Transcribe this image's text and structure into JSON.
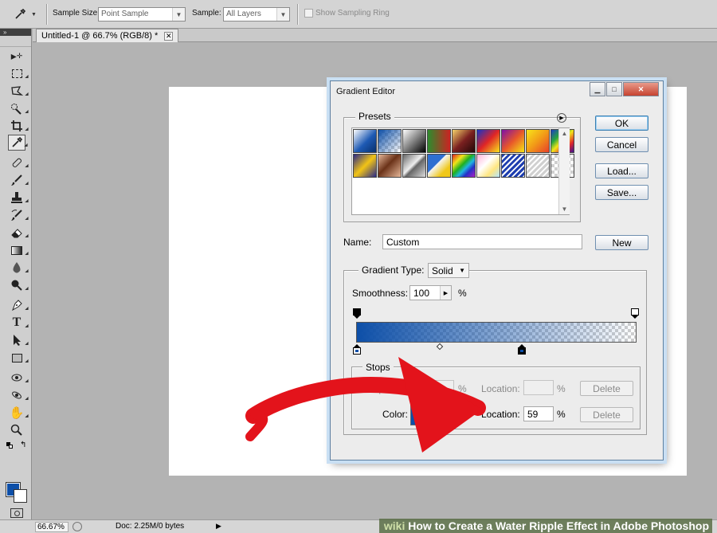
{
  "options_bar": {
    "sample_size_label": "Sample Size:",
    "sample_size_value": "Point Sample",
    "sample_label": "Sample:",
    "sample_value": "All Layers",
    "show_ring_label": "Show Sampling Ring"
  },
  "document": {
    "tab_title": "Untitled-1 @ 66.7% (RGB/8) *",
    "close_glyph": "✕"
  },
  "status_bar": {
    "zoom": "66.67%",
    "doc_info": "Doc: 2.25M/0 bytes",
    "play_glyph": "▶"
  },
  "watermark": {
    "brand": "wiki",
    "text": "How to Create a Water Ripple Effect in Adobe Photoshop"
  },
  "colors": {
    "foreground": "#0d4fa8",
    "background": "#ffffff",
    "arrow_red": "#e3131b"
  },
  "gradient_editor": {
    "title": "Gradient Editor",
    "presets_label": "Presets",
    "buttons": {
      "ok": "OK",
      "cancel": "Cancel",
      "load": "Load...",
      "save": "Save...",
      "new": "New"
    },
    "name_label": "Name:",
    "name_value": "Custom",
    "gradient_type_label": "Gradient Type:",
    "gradient_type_value": "Solid",
    "smoothness_label": "Smoothness:",
    "smoothness_value": "100",
    "percent": "%",
    "stops": {
      "legend": "Stops",
      "opacity_label": "Opacity:",
      "opacity_value": "",
      "location_label": "Location:",
      "color_label": "Color:",
      "color_location_value": "59",
      "delete_label": "Delete"
    }
  },
  "presets": [
    "linear-gradient(135deg,#ffffff,#1e5ab4 55%,#08306c)",
    "checker-blue",
    "linear-gradient(135deg,#ffffff,#000000)",
    "linear-gradient(to right,#2d8c2d,#cc2222)",
    "linear-gradient(135deg,#f5d36a,#7a2020 50%,#200808)",
    "linear-gradient(135deg,#1633c8,#e02525 50%,#f7e41e)",
    "linear-gradient(135deg,#7d10a8,#e8562a 50%,#f5e616)",
    "linear-gradient(135deg,#f8e51a,#f29b17 50%,#e8402a)",
    "linear-gradient(135deg,#1d3ec2,#27a53e 30%,#f1e51a 50%,#e12a2a 75%,#3b1094)",
    "linear-gradient(135deg,#2a2a8a,#f2c415 50%,#2a2a8a)",
    "linear-gradient(135deg,#e6b89a,#6b3218 45%,#e6b89a)",
    "linear-gradient(135deg,#666,#eee 45%,#666 55%,#ddd)",
    "linear-gradient(135deg,#2f6fd1 40%,#f5f5f5 42%,#f0c81a 75%)",
    "linear-gradient(135deg,#e12020,#f1e31a 25%,#1fb01f 45%,#1fb5e0 60%,#2430c8 75%,#b020c8)",
    "linear-gradient(135deg,#ffb3d9,#ffffff 40%,#ffe680 70%,#b3e6ff)",
    "repeating-linear-gradient(135deg,#1f3fb0 0 3px,#ffffff 3px 5px)",
    "repeating-linear-gradient(135deg,#d0d0d0 0 3px,#ffffff 3px 5px)",
    "checker"
  ]
}
